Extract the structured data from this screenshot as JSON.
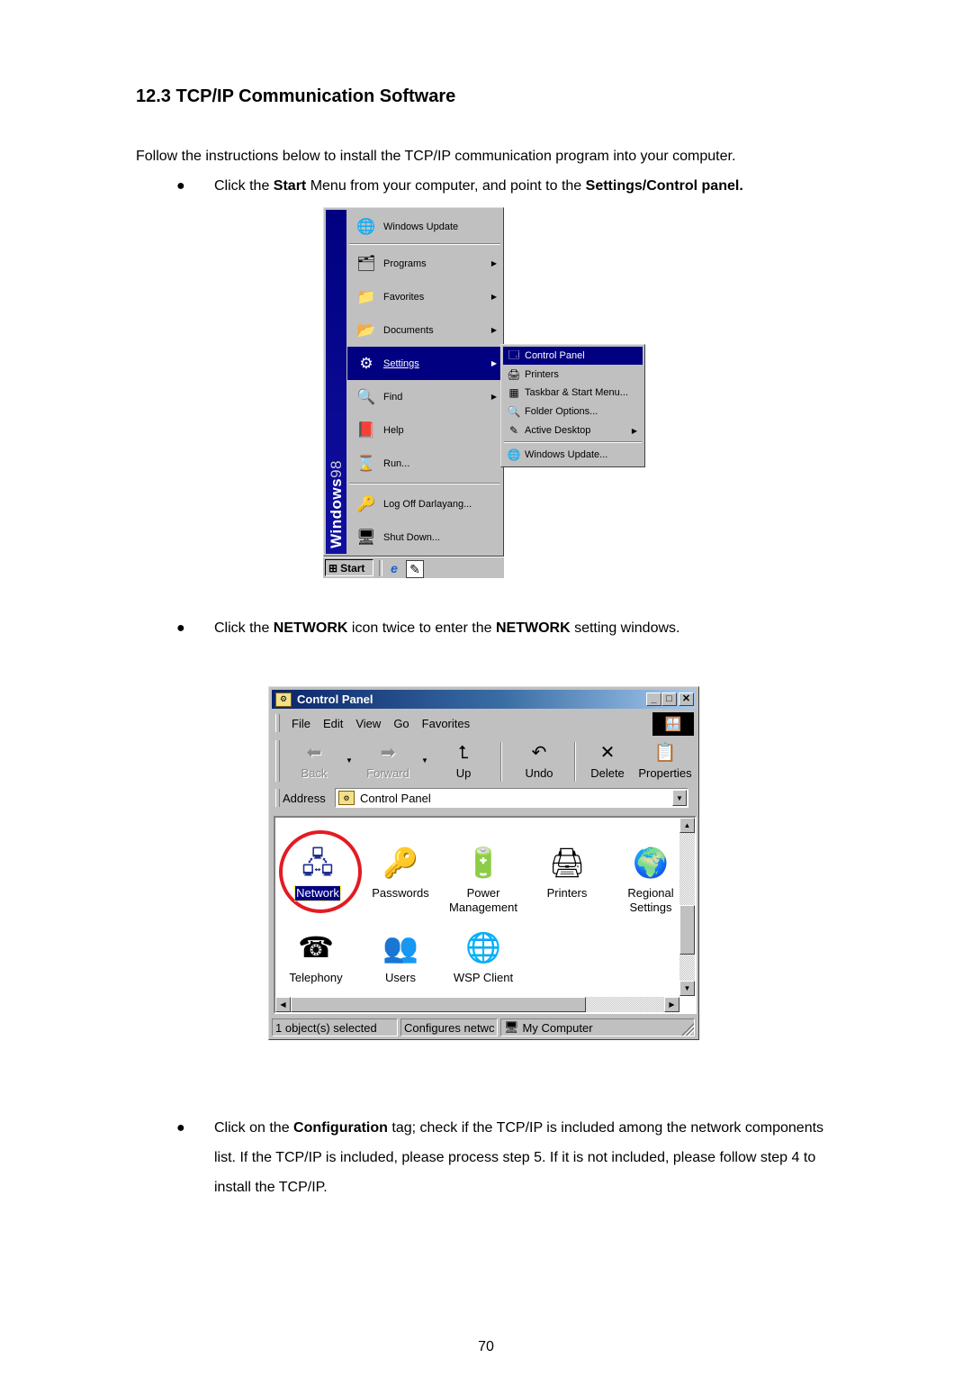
{
  "heading": "12.3 TCP/IP Communication Software",
  "intro": "Follow the instructions below to install the TCP/IP communication program into your computer.",
  "bullets": [
    {
      "parts": [
        "Click the ",
        "Start",
        " Menu from your computer, and point to the ",
        "Settings/Control panel."
      ],
      "bold": [
        false,
        true,
        false,
        true
      ]
    },
    {
      "parts": [
        "Click the ",
        "NETWORK",
        " icon twice to enter the ",
        "NETWORK",
        " setting windows."
      ],
      "bold": [
        false,
        true,
        false,
        true,
        false
      ]
    },
    {
      "parts": [
        "Click on the ",
        "Configuration",
        " tag; check if the TCP/IP is included among the network components list. If the TCP/IP is included, please process step 5. If it is not included, please follow step 4 to install the TCP/IP."
      ],
      "bold": [
        false,
        true,
        false
      ]
    }
  ],
  "bullet_glyph": "●",
  "start_menu": {
    "banner": {
      "bold": "Windows",
      "thin": "98"
    },
    "items": [
      {
        "label": "Windows Update",
        "icon": "windows-update-icon",
        "glyph": "🌐",
        "submenu": false,
        "selected": false
      },
      {
        "label": "Programs",
        "icon": "programs-folder-icon",
        "glyph": "🗂",
        "submenu": true,
        "selected": false
      },
      {
        "label": "Favorites",
        "icon": "favorites-folder-icon",
        "glyph": "📁",
        "submenu": true,
        "selected": false
      },
      {
        "label": "Documents",
        "icon": "documents-folder-icon",
        "glyph": "📂",
        "submenu": true,
        "selected": false
      },
      {
        "label": "Settings",
        "icon": "settings-icon",
        "glyph": "⚙",
        "submenu": true,
        "selected": true
      },
      {
        "label": "Find",
        "icon": "find-magnifier-icon",
        "glyph": "🔍",
        "submenu": true,
        "selected": false
      },
      {
        "label": "Help",
        "icon": "help-book-icon",
        "glyph": "📕",
        "submenu": false,
        "selected": false
      },
      {
        "label": "Run...",
        "icon": "run-icon",
        "glyph": "⌛",
        "submenu": false,
        "selected": false
      },
      {
        "label": "Log Off Darlayang...",
        "icon": "log-off-key-icon",
        "glyph": "🔑",
        "submenu": false,
        "selected": false
      },
      {
        "label": "Shut Down...",
        "icon": "shut-down-icon",
        "glyph": "🖥",
        "submenu": false,
        "selected": false
      }
    ],
    "arrow_glyph": "▶",
    "taskbar": {
      "start_label": "Start",
      "start_glyph": "⊞",
      "ie_glyph": "e",
      "desktop_glyph": "✎"
    }
  },
  "settings_submenu": {
    "items": [
      {
        "label": "Control Panel",
        "icon": "control-panel-icon",
        "glyph": "🗔",
        "submenu": false,
        "selected": true
      },
      {
        "label": "Printers",
        "icon": "printers-icon",
        "glyph": "🖨",
        "submenu": false,
        "selected": false
      },
      {
        "label": "Taskbar & Start Menu...",
        "icon": "taskbar-icon",
        "glyph": "▦",
        "submenu": false,
        "selected": false
      },
      {
        "label": "Folder Options...",
        "icon": "folder-options-icon",
        "glyph": "🔍",
        "submenu": false,
        "selected": false
      },
      {
        "label": "Active Desktop",
        "icon": "active-desktop-icon",
        "glyph": "✎",
        "submenu": true,
        "selected": false
      },
      {
        "label": "Windows Update...",
        "icon": "windows-update-icon",
        "glyph": "🌐",
        "submenu": false,
        "selected": false
      }
    ]
  },
  "control_panel": {
    "title": "Control Panel",
    "title_buttons": {
      "minimize": "_",
      "maximize": "□",
      "close": "✕"
    },
    "menu": [
      "File",
      "Edit",
      "View",
      "Go",
      "Favorites"
    ],
    "toolbar": [
      {
        "label": "Back",
        "glyph": "⬅",
        "enabled": false,
        "dropdown": true
      },
      {
        "label": "Forward",
        "glyph": "➡",
        "enabled": false,
        "dropdown": true
      },
      {
        "label": "Up",
        "glyph": "⮤",
        "enabled": true,
        "dropdown": false
      },
      {
        "label": "Undo",
        "glyph": "↶",
        "enabled": true,
        "dropdown": false
      },
      {
        "label": "Delete",
        "glyph": "✕",
        "enabled": true,
        "dropdown": false
      },
      {
        "label": "Properties",
        "glyph": "📋",
        "enabled": true,
        "dropdown": false
      }
    ],
    "address_label": "Address",
    "address_value": "Control Panel",
    "icons": [
      {
        "label": "Network",
        "icon": "network-icon",
        "glyph": "🖧",
        "selected": true,
        "highlighted": true
      },
      {
        "label": "Passwords",
        "icon": "passwords-keys-icon",
        "glyph": "🔑",
        "selected": false
      },
      {
        "label": "Power Management",
        "icon": "power-management-icon",
        "glyph": "🔋",
        "selected": false
      },
      {
        "label": "Printers",
        "icon": "printers-folder-icon",
        "glyph": "🖨",
        "selected": false
      },
      {
        "label": "Regional Settings",
        "icon": "regional-settings-globe-icon",
        "glyph": "🌍",
        "selected": false
      },
      {
        "label": "Telephony",
        "icon": "telephony-icon",
        "glyph": "☎",
        "selected": false
      },
      {
        "label": "Users",
        "icon": "users-icon",
        "glyph": "👥",
        "selected": false
      },
      {
        "label": "WSP Client",
        "icon": "wsp-client-icon",
        "glyph": "🌐",
        "selected": false
      }
    ],
    "status": {
      "selected": "1 object(s) selected",
      "description": "Configures netwc",
      "location": "My Computer",
      "location_glyph": "🖥"
    }
  },
  "highlight_color": "#e31b23",
  "page_number": "70"
}
